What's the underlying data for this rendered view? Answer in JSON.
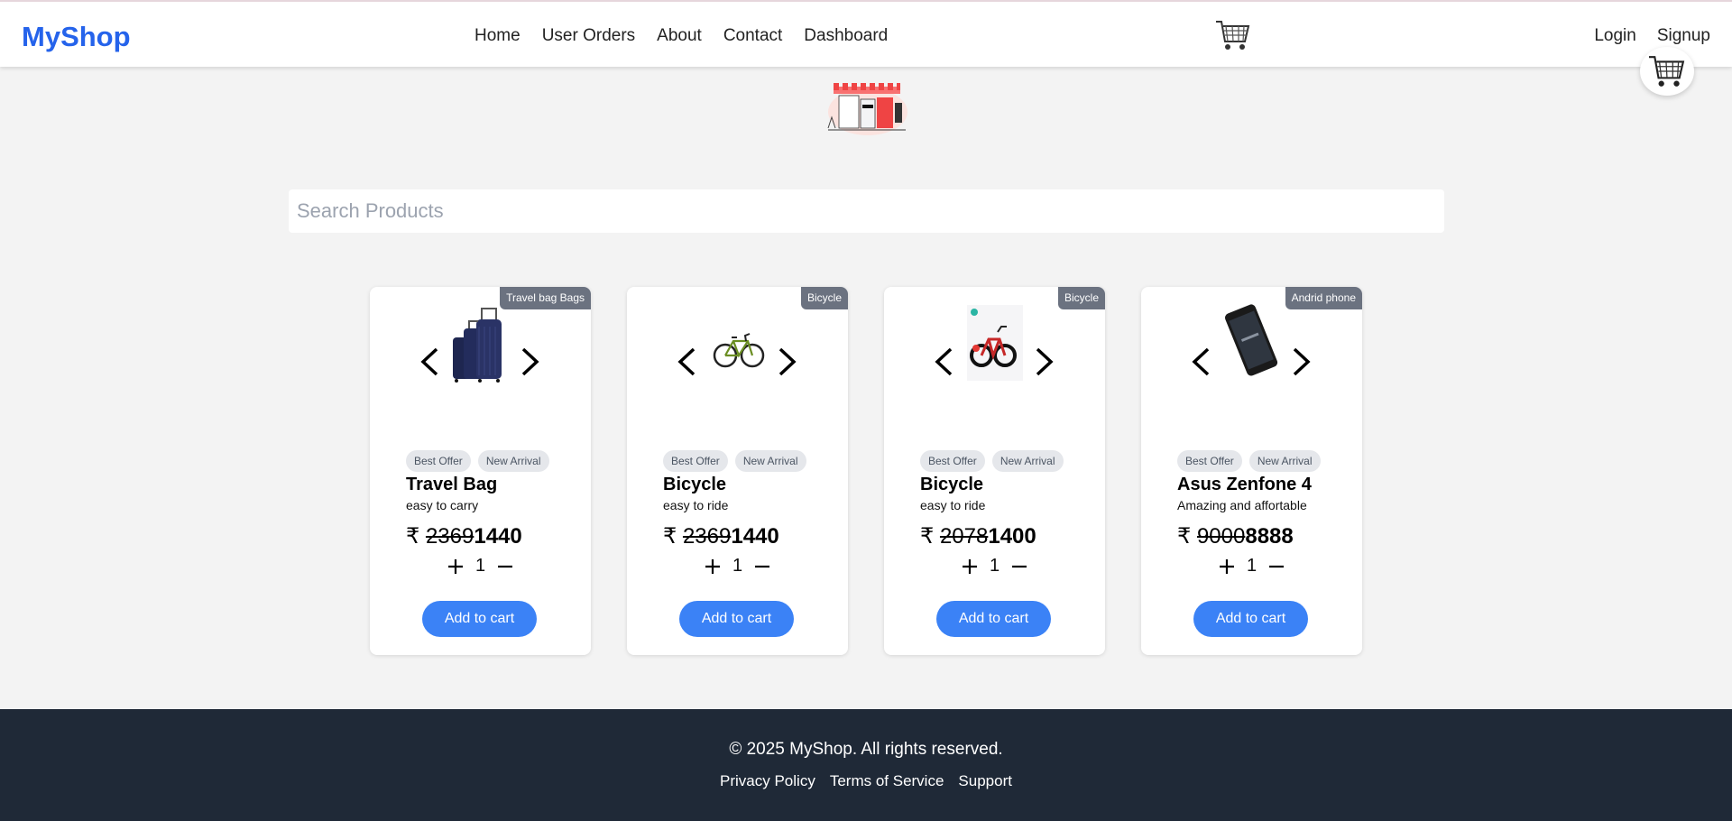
{
  "navbar": {
    "brand": "MyShop",
    "links": [
      "Home",
      "User Orders",
      "About",
      "Contact",
      "Dashboard"
    ],
    "auth": [
      "Login",
      "Signup"
    ]
  },
  "search": {
    "placeholder": "Search Products",
    "value": ""
  },
  "currency": "₹",
  "products": [
    {
      "category": "Travel bag Bags",
      "tags": [
        "Best Offer",
        "New Arrival"
      ],
      "name": "Travel Bag",
      "description": "easy to carry",
      "old_price": "2369",
      "new_price": "1440",
      "quantity": "1",
      "button": "Add to cart",
      "image_icon": "luggage-image"
    },
    {
      "category": "Bicycle",
      "tags": [
        "Best Offer",
        "New Arrival"
      ],
      "name": "Bicycle",
      "description": "easy to ride",
      "old_price": "2369",
      "new_price": "1440",
      "quantity": "1",
      "button": "Add to cart",
      "image_icon": "bicycle-image"
    },
    {
      "category": "Bicycle",
      "tags": [
        "Best Offer",
        "New Arrival"
      ],
      "name": "Bicycle",
      "description": "easy to ride",
      "old_price": "2078",
      "new_price": "1400",
      "quantity": "1",
      "button": "Add to cart",
      "image_icon": "kids-bicycle-image"
    },
    {
      "category": "Andrid phone",
      "tags": [
        "Best Offer",
        "New Arrival"
      ],
      "name": "Asus Zenfone 4",
      "description": "Amazing and affortable",
      "old_price": "9000",
      "new_price": "8888",
      "quantity": "1",
      "button": "Add to cart",
      "image_icon": "smartphone-image"
    }
  ],
  "footer": {
    "copyright": "© 2025 MyShop. All rights reserved.",
    "links": [
      "Privacy Policy",
      "Terms of Service",
      "Support"
    ]
  },
  "colors": {
    "brand": "#2563eb",
    "button": "#3b82f6",
    "footer_bg": "#1f2937",
    "badge_bg": "#6b7280"
  }
}
